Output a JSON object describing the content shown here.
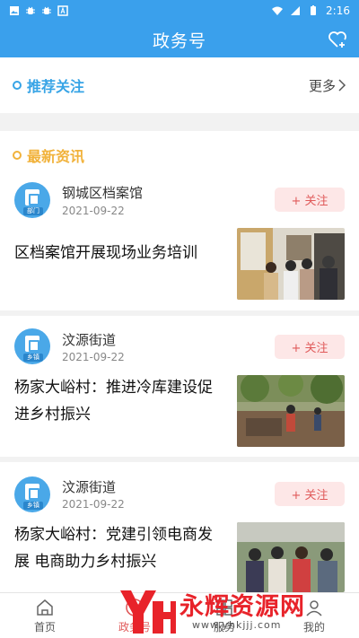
{
  "status_bar": {
    "time": "2:16"
  },
  "header": {
    "title": "政务号"
  },
  "recommend": {
    "title": "推荐关注",
    "more_label": "更多"
  },
  "news_section": {
    "title": "最新资讯"
  },
  "articles": [
    {
      "source": "钢城区档案馆",
      "badge": "部门",
      "date": "2021-09-22",
      "follow_label": "+ 关注",
      "title": "区档案馆开展现场业务培训"
    },
    {
      "source": "汶源街道",
      "badge": "乡镇",
      "date": "2021-09-22",
      "follow_label": "+ 关注",
      "title": "杨家大峪村：推进冷库建设促进乡村振兴"
    },
    {
      "source": "汶源街道",
      "badge": "乡镇",
      "date": "2021-09-22",
      "follow_label": "+ 关注",
      "title": "杨家大峪村：党建引领电商发展 电商助力乡村振兴"
    }
  ],
  "bottom_nav": [
    {
      "label": "首页",
      "icon": "home-icon",
      "active": false
    },
    {
      "label": "政务号",
      "icon": "gov-account-icon",
      "active": true
    },
    {
      "label": "服务",
      "icon": "service-icon",
      "active": false
    },
    {
      "label": "我的",
      "icon": "profile-icon",
      "active": false
    }
  ],
  "watermark": {
    "text": "永辉资源网",
    "url": "www.yhkjjj.com"
  },
  "colors": {
    "primary": "#3aa0ec",
    "follow_bg": "#fde7e7",
    "follow_text": "#e05a5a",
    "recommend_accent": "#37a4e6",
    "news_accent": "#f1b23b"
  }
}
